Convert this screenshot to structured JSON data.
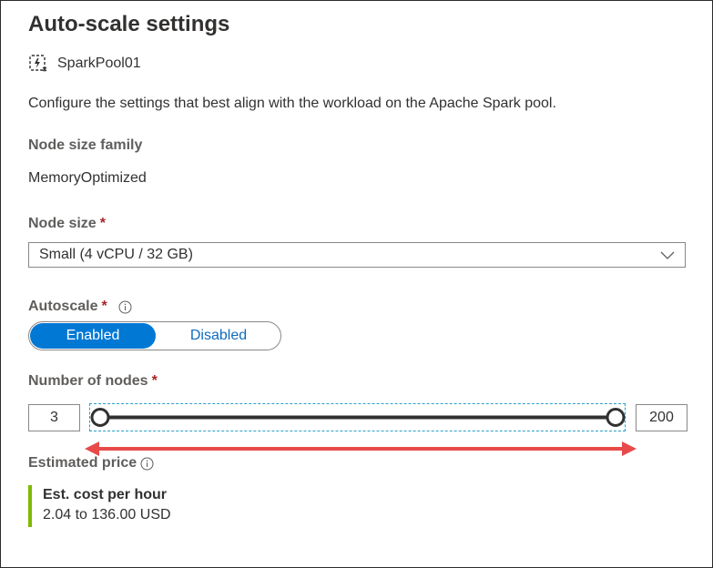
{
  "title": "Auto-scale settings",
  "pool": {
    "name": "SparkPool01",
    "icon": "spark-pool-icon"
  },
  "description": "Configure the settings that best align with the workload on the Apache Spark pool.",
  "node_size_family": {
    "label": "Node size family",
    "value": "MemoryOptimized"
  },
  "node_size": {
    "label": "Node size",
    "required_mark": "*",
    "selected": "Small (4 vCPU / 32 GB)"
  },
  "autoscale": {
    "label": "Autoscale",
    "required_mark": "*",
    "options": [
      "Enabled",
      "Disabled"
    ],
    "selected": "Enabled"
  },
  "number_of_nodes": {
    "label": "Number of nodes",
    "required_mark": "*",
    "min": "3",
    "max": "200"
  },
  "estimated_price": {
    "label": "Estimated price",
    "cost_title": "Est. cost per hour",
    "cost_value": "2.04 to 136.00 USD"
  },
  "colors": {
    "accent": "#0078d4",
    "required": "#a4262c",
    "price_bar": "#7fba00",
    "annotation_arrow": "#e84a4a",
    "focus_outline": "#2aa0c8"
  }
}
